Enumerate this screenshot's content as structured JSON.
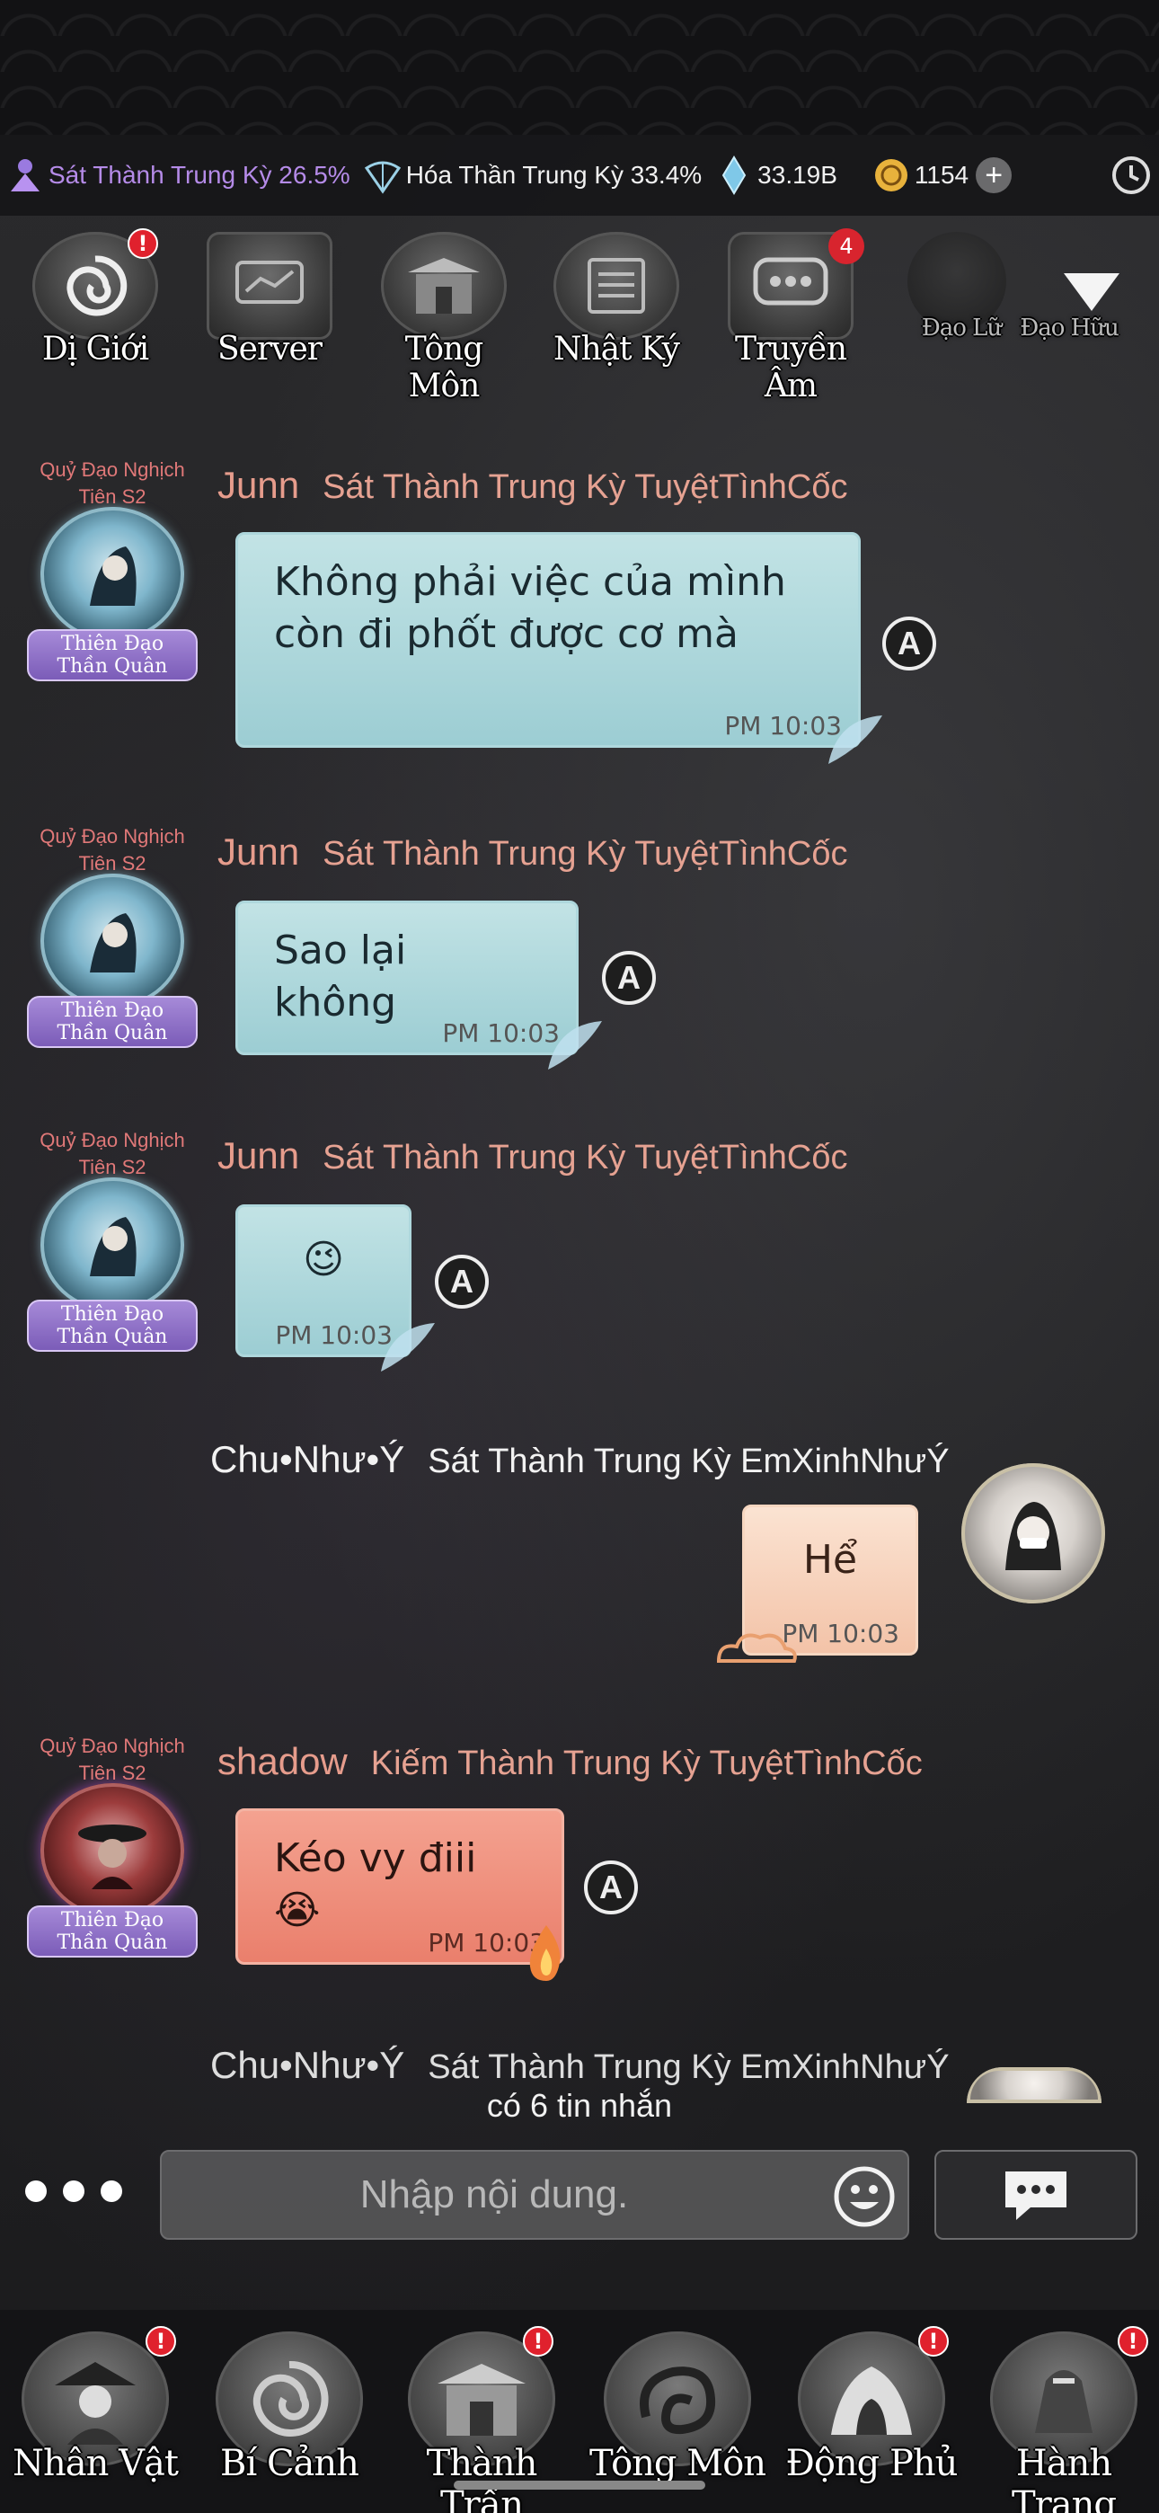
{
  "resources": {
    "realm1": "Sát Thành Trung Kỳ 26.5%",
    "realm2": "Hóa Thần Trung Kỳ 33.4%",
    "crystal": "33.19B",
    "coin": "1154",
    "plus": "+"
  },
  "top_menu": {
    "items": [
      {
        "label": "Dị Giới",
        "badge": "!"
      },
      {
        "label": "Server"
      },
      {
        "label": "Tông Môn"
      },
      {
        "label": "Nhật Ký"
      },
      {
        "label": "Truyền Âm",
        "badge": "4"
      },
      {
        "label": "Đạo Lữ"
      },
      {
        "label": "Đạo Hữu"
      }
    ]
  },
  "messages": [
    {
      "title": "Quỷ Đạo Nghịch Tiên S2",
      "rank": "Thiên Đạo Thần Quân",
      "name": "Junn",
      "info": "Sát Thành Trung Kỳ  TuyệtTìnhCốc",
      "text_line1": "Không phải việc của mình",
      "text_line2": "còn đi phốt được cơ mà",
      "time": "PM 10:03"
    },
    {
      "title": "Quỷ Đạo Nghịch Tiên S2",
      "rank": "Thiên Đạo Thần Quân",
      "name": "Junn",
      "info": "Sát Thành Trung Kỳ  TuyệtTìnhCốc",
      "text": "Sao lại không",
      "time": "PM 10:03"
    },
    {
      "title": "Quỷ Đạo Nghịch Tiên S2",
      "rank": "Thiên Đạo Thần Quân",
      "name": "Junn",
      "info": "Sát Thành Trung Kỳ  TuyệtTìnhCốc",
      "text": "😉",
      "time": "PM 10:03"
    },
    {
      "name": "Chu•Như•Ý",
      "info": "Sát Thành Trung Kỳ  EmXinhNhưÝ",
      "text": "Hể",
      "time": "PM 10:03"
    },
    {
      "title": "Quỷ Đạo Nghịch Tiên S2",
      "rank": "Thiên Đạo Thần Quân",
      "name": "shadow",
      "info": "Kiếm Thành Trung Kỳ  TuyệtTìnhCốc",
      "text": "Kéo vy điii 😭",
      "time": "PM 10:03"
    },
    {
      "name": "Chu•Như•Ý",
      "info": "Sát Thành Trung Kỳ  EmXinhNhưÝ"
    }
  ],
  "new_messages": "có 6 tin nhắn",
  "input": {
    "placeholder": "Nhập nội dung."
  },
  "bottom_nav": {
    "items": [
      {
        "label": "Nhân Vật",
        "badge": "!"
      },
      {
        "label": "Bí Cảnh"
      },
      {
        "label": "Thành Trấn",
        "badge": "!"
      },
      {
        "label": "Tông Môn"
      },
      {
        "label": "Động Phủ",
        "badge": "!"
      },
      {
        "label": "Hành Trang",
        "badge": "!"
      }
    ]
  },
  "colors": {
    "bubble_teal": "#a8d6da",
    "bubble_peach": "#f6d0b8",
    "bubble_red": "#ee8e7c",
    "name_color": "#e69c8c",
    "rank_purple": "#8e6fcb"
  }
}
